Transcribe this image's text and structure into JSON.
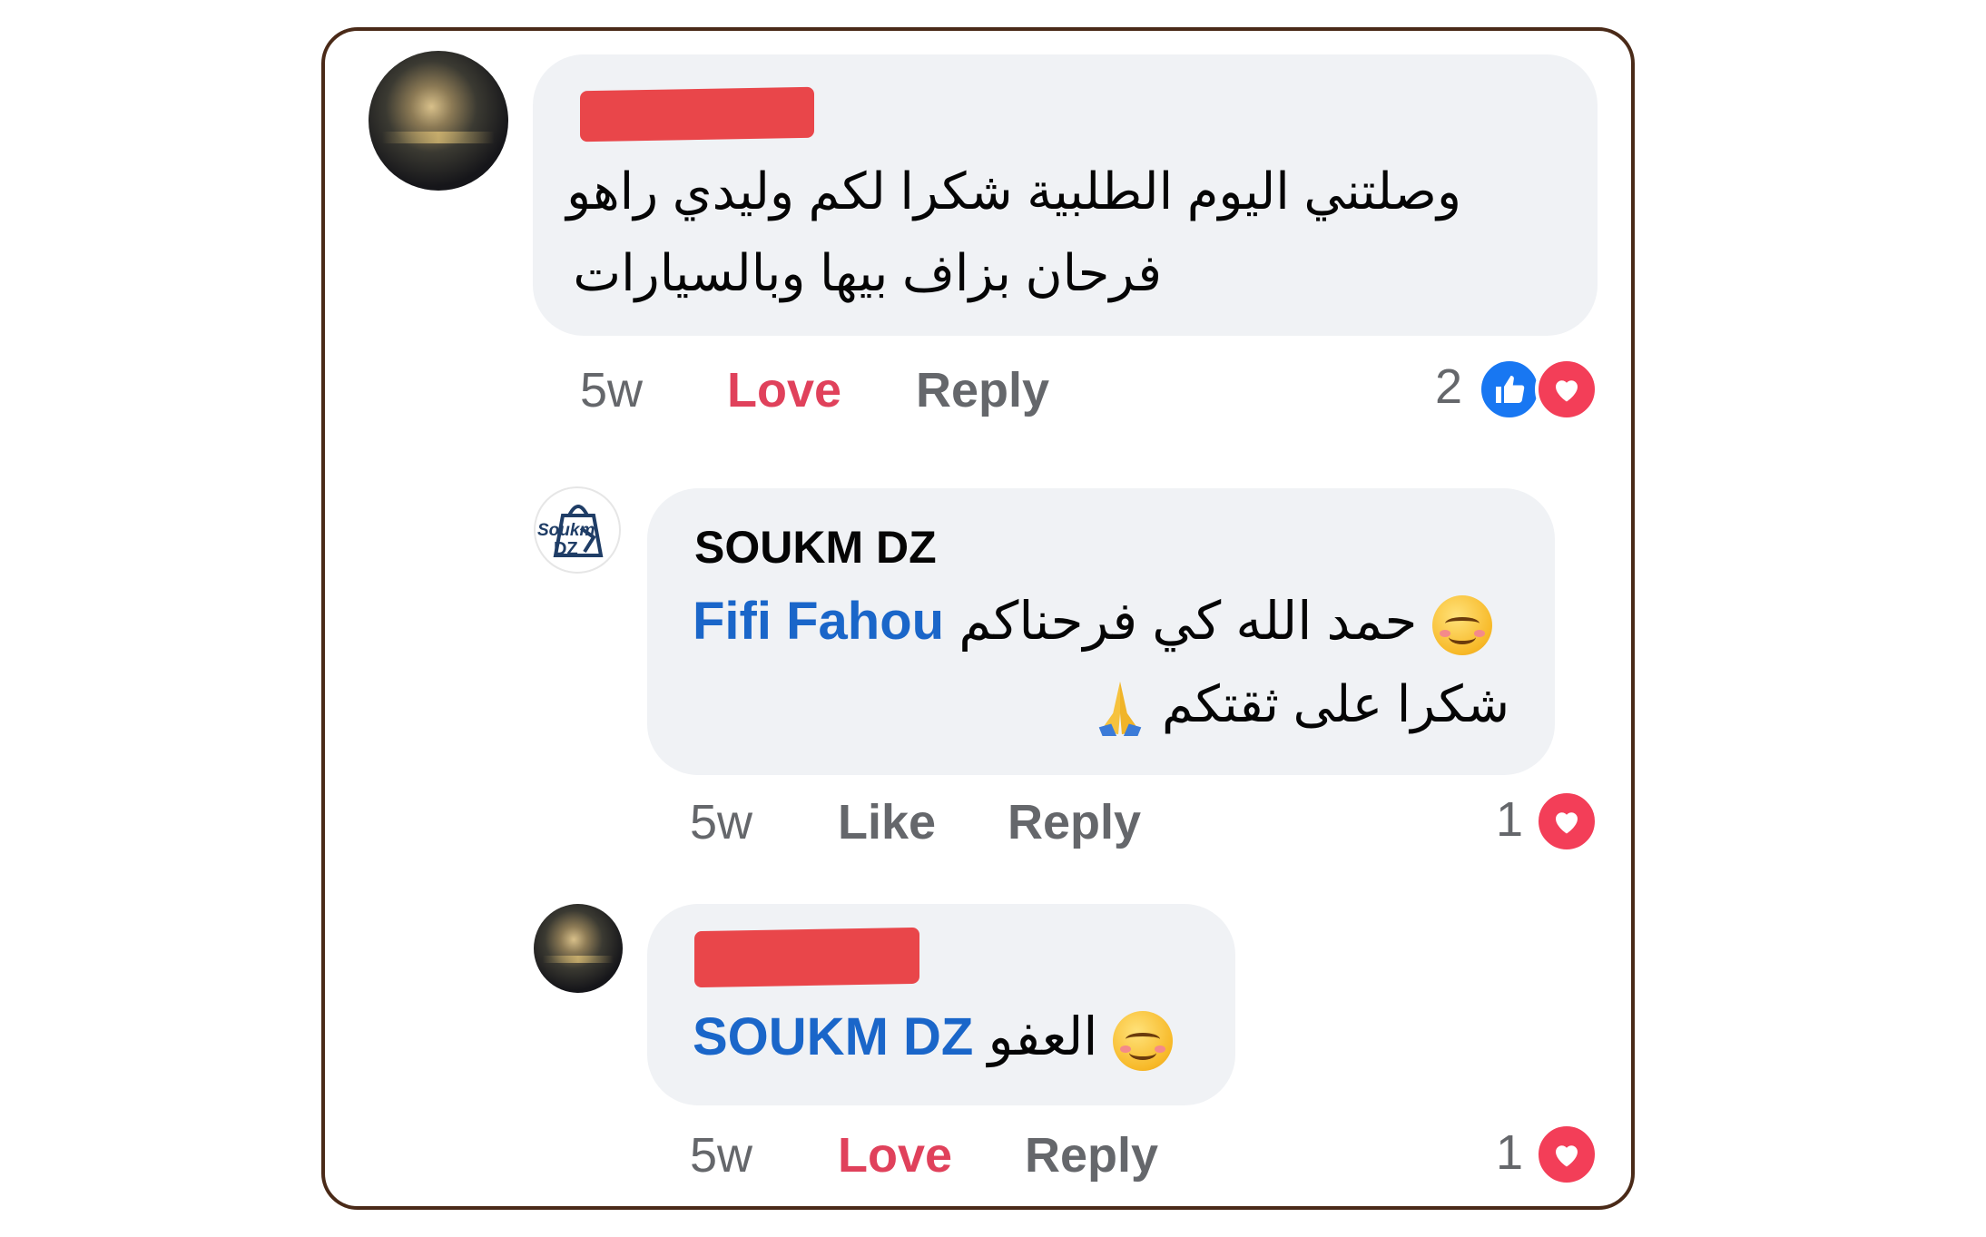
{
  "comments": [
    {
      "author": "",
      "text_line1": "وصلتني اليوم الطلبية شكرا لكم وليدي راهو",
      "text_line2": "فرحان بزاف بيها وبالسيارات",
      "time": "5w",
      "action1": "Love",
      "action2": "Reply",
      "reaction_count": "2",
      "reactions": [
        "like-icon",
        "heart-icon"
      ]
    },
    {
      "author": "SOUKM DZ",
      "mention": "Fifi Fahou",
      "text_line1": "حمد الله كي فرحناكم",
      "text_line2": "شكرا على ثقتكم",
      "time": "5w",
      "action1": "Like",
      "action2": "Reply",
      "reaction_count": "1",
      "reactions": [
        "heart-icon"
      ]
    },
    {
      "author": "",
      "mention": "SOUKM DZ",
      "text_line1": "العفو",
      "time": "5w",
      "action1": "Love",
      "action2": "Reply",
      "reaction_count": "1",
      "reactions": [
        "heart-icon"
      ]
    }
  ],
  "avatar_logo": {
    "line1": "Soukm",
    "line2": "DZ"
  },
  "colors": {
    "bubble": "#f0f2f5",
    "mention": "#1a66c9",
    "love": "#e0415b",
    "like": "#1877f2",
    "heart": "#f33e58",
    "frame": "#4a2a18"
  }
}
